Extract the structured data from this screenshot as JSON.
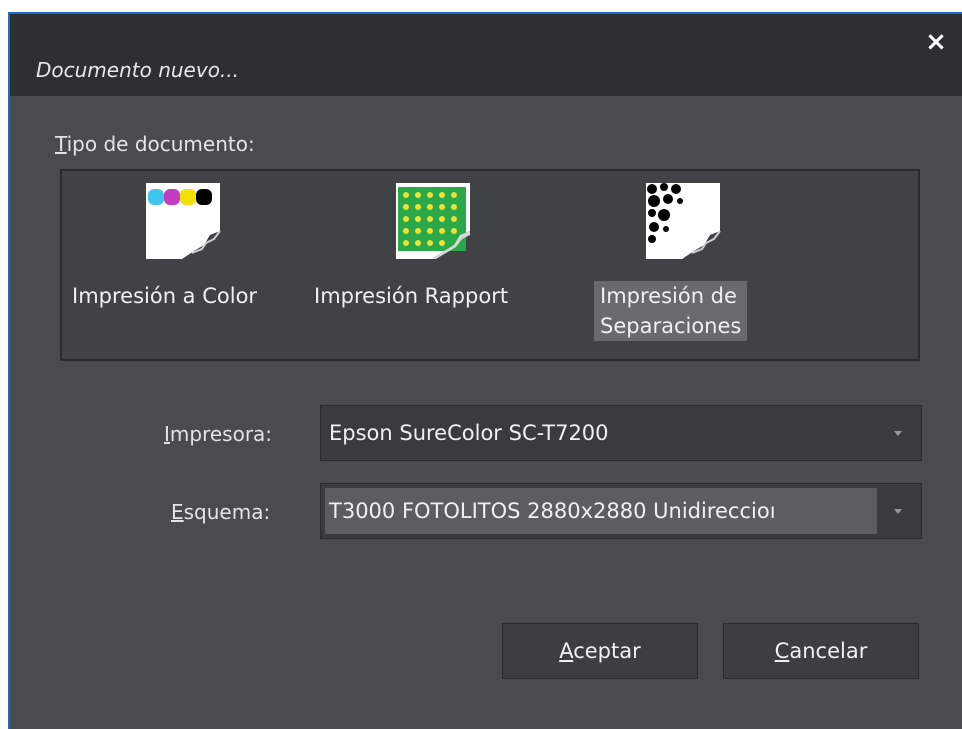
{
  "window": {
    "title": "Documento nuevo...",
    "close_glyph": "×"
  },
  "doc_type": {
    "label_first": "T",
    "label_rest": "ipo de documento:",
    "items": [
      {
        "label": "Impresión a Color",
        "icon": "color-print-icon",
        "selected": false
      },
      {
        "label": "Impresión Rapport",
        "icon": "rapport-print-icon",
        "selected": false
      },
      {
        "label_line1": "Impresión de",
        "label_line2": "Separaciones",
        "icon": "separations-print-icon",
        "selected": true
      }
    ]
  },
  "printer": {
    "label_first": "I",
    "label_rest": "mpresora:",
    "value": "Epson SureColor SC-T7200"
  },
  "scheme": {
    "label_first": "E",
    "label_rest": "squema:",
    "value": "T3000 FOTOLITOS 2880x2880 Unidireccioı"
  },
  "buttons": {
    "accept_first": "A",
    "accept_rest": "ceptar",
    "cancel_first": "C",
    "cancel_rest": "ancelar"
  },
  "colors": {
    "window_bg": "#4a4b4f",
    "titlebar_bg": "#2e2f31",
    "border_accent": "#1e6cc4"
  }
}
